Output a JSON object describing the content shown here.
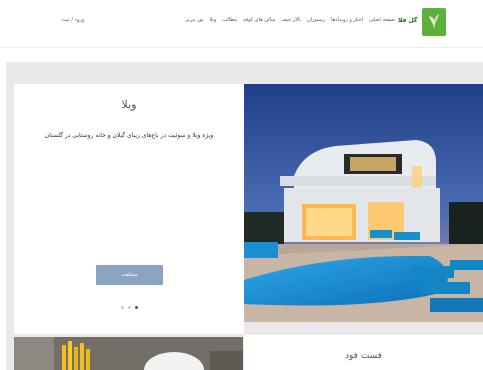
{
  "header": {
    "brand_name": "گل فلا",
    "nav": [
      "صفحه اصلی",
      "اخبار و رویدادها",
      "رستوران",
      "تالار چیف",
      "سالن های کوفه",
      "مطالب",
      "ویلا",
      "تور تبریز"
    ],
    "login_label": "ورود / ثبت"
  },
  "card": {
    "title": "ویلا",
    "description": "ویژه ویلا و سوئیت در باغ‌های زیبای گیلان و خانه روستایی در گلستان",
    "button_label": "مشاهده",
    "slides_total": 3,
    "active_slide": 3
  },
  "card2": {
    "title": "فست فود"
  },
  "colors": {
    "brand_green": "#5bb23a",
    "button": "#8aa4c1",
    "section_bg": "#e9e9e9"
  }
}
